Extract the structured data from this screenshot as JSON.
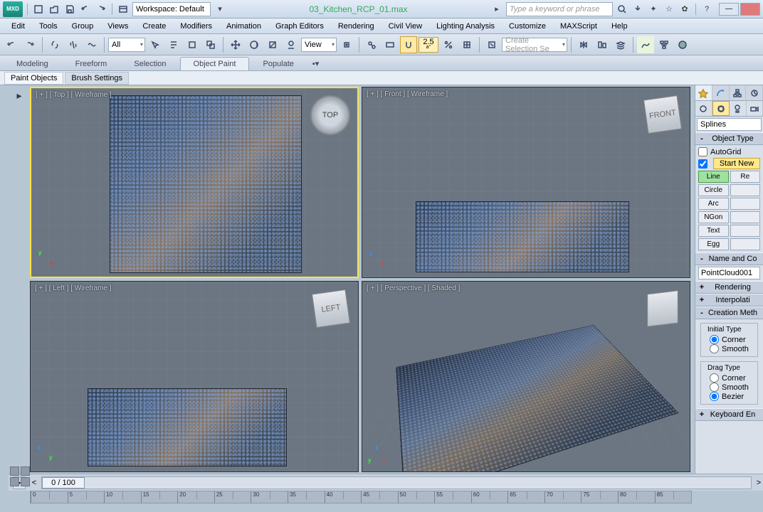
{
  "app_label": "MXD",
  "workspace": {
    "label": "Workspace: Default"
  },
  "file_title": "03_Kitchen_RCP_01.max",
  "search_placeholder": "Type a keyword or phrase",
  "menus": [
    "Edit",
    "Tools",
    "Group",
    "Views",
    "Create",
    "Modifiers",
    "Animation",
    "Graph Editors",
    "Rendering",
    "Civil View",
    "Lighting Analysis",
    "Customize",
    "MAXScript",
    "Help"
  ],
  "selection_filter": "All",
  "refcoord": "View",
  "angle_snap": "2.5",
  "selection_set_placeholder": "Create Selection Se",
  "ribbon_tabs": [
    "Modeling",
    "Freeform",
    "Selection",
    "Object Paint",
    "Populate"
  ],
  "ribbon_active": "Object Paint",
  "sub_tabs": [
    "Paint Objects",
    "Brush Settings"
  ],
  "sub_active": "Paint Objects",
  "viewports": {
    "top": {
      "label": "[ + ] [ Top ] [ Wireframe ]",
      "cube": "TOP"
    },
    "front": {
      "label": "[ + ] [ Front ] [ Wireframe ]",
      "cube": "FRONT"
    },
    "left": {
      "label": "[ + ] [ Left ] [ Wireframe ]",
      "cube": "LEFT"
    },
    "perspective": {
      "label": "[ + ] [ Perspective ] [ Shaded ]",
      "cube": ""
    }
  },
  "command_panel": {
    "category": "Splines",
    "rollouts": {
      "object_type": {
        "title": "Object Type",
        "autogrid": "AutoGrid",
        "start_new": "Start New"
      },
      "name_color": {
        "title": "Name and Co"
      },
      "rendering": {
        "title": "Rendering"
      },
      "interpolation": {
        "title": "Interpolati"
      },
      "creation_method": {
        "title": "Creation Meth"
      },
      "keyboard": {
        "title": "Keyboard En"
      }
    },
    "spline_buttons_left": [
      "Line",
      "Circle",
      "Arc",
      "NGon",
      "Text",
      "Egg"
    ],
    "spline_buttons_right": [
      "Re",
      "",
      "",
      "",
      "",
      ""
    ],
    "initial_type": {
      "title": "Initial Type",
      "options": [
        "Corner",
        "Smooth"
      ],
      "selected": "Corner"
    },
    "drag_type": {
      "title": "Drag Type",
      "options": [
        "Corner",
        "Smooth",
        "Bezier"
      ],
      "selected": "Bezier"
    },
    "object_name": "PointCloud001"
  },
  "timeline": {
    "pos_label": "0 / 100",
    "ticks": [
      "0",
      "5",
      "10",
      "15",
      "20",
      "25",
      "30",
      "35",
      "40",
      "45",
      "50",
      "55",
      "60",
      "65",
      "70",
      "75",
      "80",
      "85"
    ]
  }
}
